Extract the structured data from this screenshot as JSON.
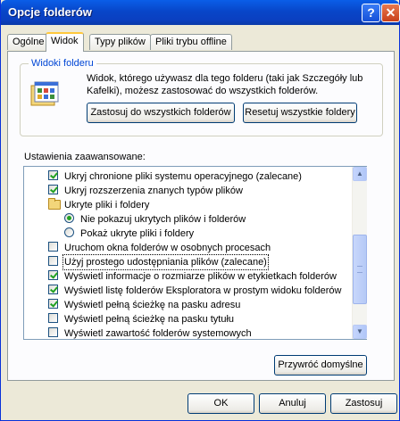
{
  "window": {
    "title": "Opcje folderów",
    "help_glyph": "?",
    "close_glyph": "✕"
  },
  "tabs": [
    {
      "label": "Ogólne",
      "active": false
    },
    {
      "label": "Widok",
      "active": true
    },
    {
      "label": "Typy plików",
      "active": false
    },
    {
      "label": "Pliki trybu offline",
      "active": false
    }
  ],
  "folder_views": {
    "legend": "Widoki folderu",
    "description": "Widok, którego używasz dla tego folderu (taki jak Szczegóły lub Kafelki), możesz zastosować do wszystkich folderów.",
    "apply_all_label": "Zastosuj do wszystkich folderów",
    "reset_all_label": "Resetuj wszystkie foldery"
  },
  "advanced": {
    "label": "Ustawienia zaawansowane:",
    "items": [
      {
        "type": "checkbox",
        "indent": 1,
        "checked": true,
        "label": "Ukryj chronione pliki systemu operacyjnego (zalecane)"
      },
      {
        "type": "checkbox",
        "indent": 1,
        "checked": true,
        "label": "Ukryj rozszerzenia znanych typów plików"
      },
      {
        "type": "folder",
        "indent": 1,
        "checked": false,
        "label": "Ukryte pliki i foldery"
      },
      {
        "type": "radio",
        "indent": 2,
        "checked": true,
        "label": "Nie pokazuj ukrytych plików i folderów"
      },
      {
        "type": "radio",
        "indent": 2,
        "checked": false,
        "label": "Pokaż ukryte pliki i foldery"
      },
      {
        "type": "checkbox",
        "indent": 1,
        "checked": false,
        "label": "Uruchom okna folderów w osobnych procesach"
      },
      {
        "type": "checkbox",
        "indent": 1,
        "checked": false,
        "focused": true,
        "label": "Użyj prostego udostępniania plików (zalecane)"
      },
      {
        "type": "checkbox",
        "indent": 1,
        "checked": true,
        "label": "Wyświetl informacje o rozmiarze plików w etykietkach folderów"
      },
      {
        "type": "checkbox",
        "indent": 1,
        "checked": true,
        "label": "Wyświetl listę folderów Eksploratora w prostym widoku folderów"
      },
      {
        "type": "checkbox",
        "indent": 1,
        "checked": true,
        "label": "Wyświetl pełną ścieżkę na pasku adresu"
      },
      {
        "type": "checkbox",
        "indent": 1,
        "checked": false,
        "label": "Wyświetl pełną ścieżkę na pasku tytułu"
      },
      {
        "type": "checkbox",
        "indent": 1,
        "checked": false,
        "label": "Wyświetl zawartość folderów systemowych"
      }
    ],
    "restore_defaults_label": "Przywróć domyślne"
  },
  "footer": {
    "ok_label": "OK",
    "cancel_label": "Anuluj",
    "apply_label": "Zastosuj"
  }
}
